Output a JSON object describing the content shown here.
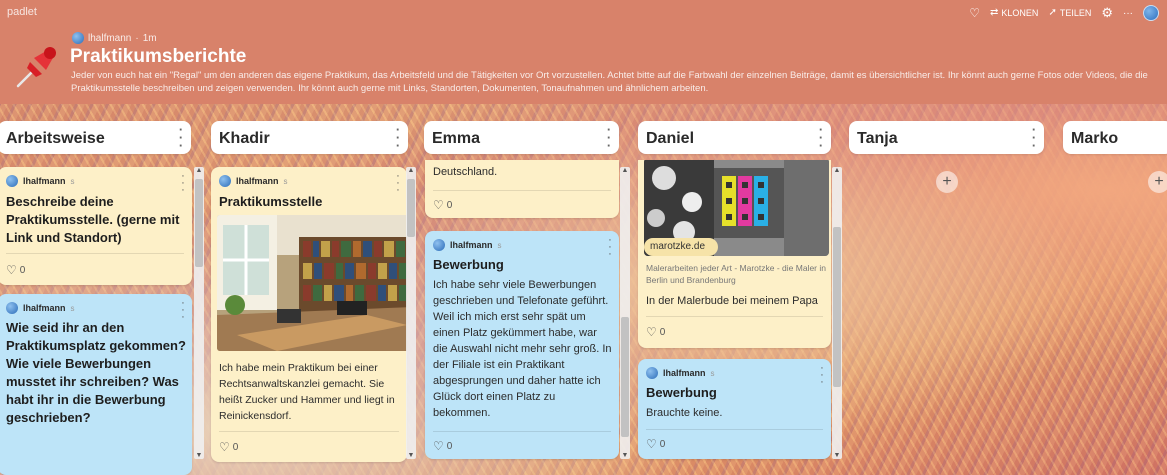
{
  "app": {
    "brand": "padlet"
  },
  "toolbar": {
    "clone_label": "KLONEN",
    "share_label": "TEILEN",
    "more_label": "···"
  },
  "board": {
    "author": "lhalfmann",
    "time": "1m",
    "title": "Praktikumsberichte",
    "description": "Jeder von euch hat ein \"Regal\" um den anderen das eigene Praktikum, das Arbeitsfeld und die Tätigkeiten vor Ort vorzustellen. Achtet bitte auf die Farbwahl der einzelnen Beiträge, damit es übersichtlicher ist. Ihr könnt auch gerne Fotos oder Videos, die die Praktikumsstelle beschreiben und zeigen verwenden. Ihr könnt auch gerne mit Links, Standorten, Dokumenten, Tonaufnahmen und ähnlichem arbeiten."
  },
  "columns": [
    {
      "name": "Arbeitsweise"
    },
    {
      "name": "Khadir"
    },
    {
      "name": "Emma"
    },
    {
      "name": "Daniel"
    },
    {
      "name": "Tanja"
    },
    {
      "name": "Marko"
    }
  ],
  "cards": {
    "arbeitsweise_1": {
      "author": "lhalfmann",
      "suffix": "s",
      "title": "Beschreibe deine Praktikumsstelle. (gerne mit Link und Standort)",
      "likes": "0"
    },
    "arbeitsweise_2": {
      "author": "lhalfmann",
      "suffix": "s",
      "title": "Wie seid ihr an den Praktikumsplatz gekommen? Wie viele Bewerbungen musstet ihr schreiben? Was habt ihr in die Bewerbung geschrieben?"
    },
    "khadir_1": {
      "author": "lhalfmann",
      "suffix": "s",
      "title": "Praktikumsstelle",
      "text": "Ich habe mein Praktikum bei einer Rechtsanwaltskanzlei gemacht. Sie heißt Zucker und Hammer und liegt in Reinickensdorf.",
      "likes": "0"
    },
    "emma_1": {
      "text": "Deutschland.",
      "likes": "0"
    },
    "emma_2": {
      "author": "lhalfmann",
      "suffix": "s",
      "title": "Bewerbung",
      "text": "Ich habe sehr viele Bewerbungen geschrieben und Telefonate geführt. Weil ich mich erst sehr spät um einen Platz gekümmert habe, war die Auswahl nicht mehr sehr groß. In der Filiale ist ein Praktikant abgesprungen und daher hatte ich Glück dort einen Platz zu bekommen.",
      "likes": "0"
    },
    "daniel_1": {
      "link_domain": "marotzke.de",
      "link_description": "Malerarbeiten jeder Art - Marotzke - die Maler in Berlin und Brandenburg",
      "text": "In der Malerbude bei meinem Papa",
      "likes": "0"
    },
    "daniel_2": {
      "author": "lhalfmann",
      "suffix": "s",
      "title": "Bewerbung",
      "text": "Brauchte keine.",
      "likes": "0"
    }
  },
  "colors": {
    "header_bg": "#d8826a",
    "card_yellow": "#fdf0c8",
    "card_blue": "#bde4f8"
  }
}
